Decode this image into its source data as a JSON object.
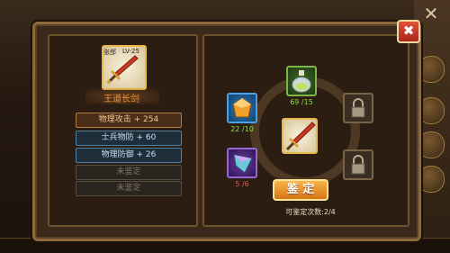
{
  "item": {
    "name_tag": "张郃",
    "level": "LV-25",
    "title": "王道长剑",
    "title_color": "#f0932e"
  },
  "stats": [
    {
      "label": "物理攻击 + 254",
      "style": "orange"
    },
    {
      "label": "士兵物防 + 60",
      "style": "blue"
    },
    {
      "label": "物理防御 + 26",
      "style": "blue"
    },
    {
      "label": "未鉴定",
      "style": "empty"
    },
    {
      "label": "未鉴定",
      "style": "empty"
    }
  ],
  "materials": {
    "potion": {
      "icon": "potion-icon",
      "count": "69 /15"
    },
    "gem": {
      "icon": "orange-gem-icon",
      "count": "22 /10"
    },
    "shard": {
      "icon": "purple-shard-icon",
      "count": "5 /6"
    }
  },
  "actions": {
    "identify_label": "鉴 定",
    "remaining_text": "可鉴定次数:2/4",
    "close_label": "✖"
  },
  "colors": {
    "accent_orange": "#f0932e",
    "count_green": "#8fe04a",
    "count_red": "#e35a5a"
  }
}
